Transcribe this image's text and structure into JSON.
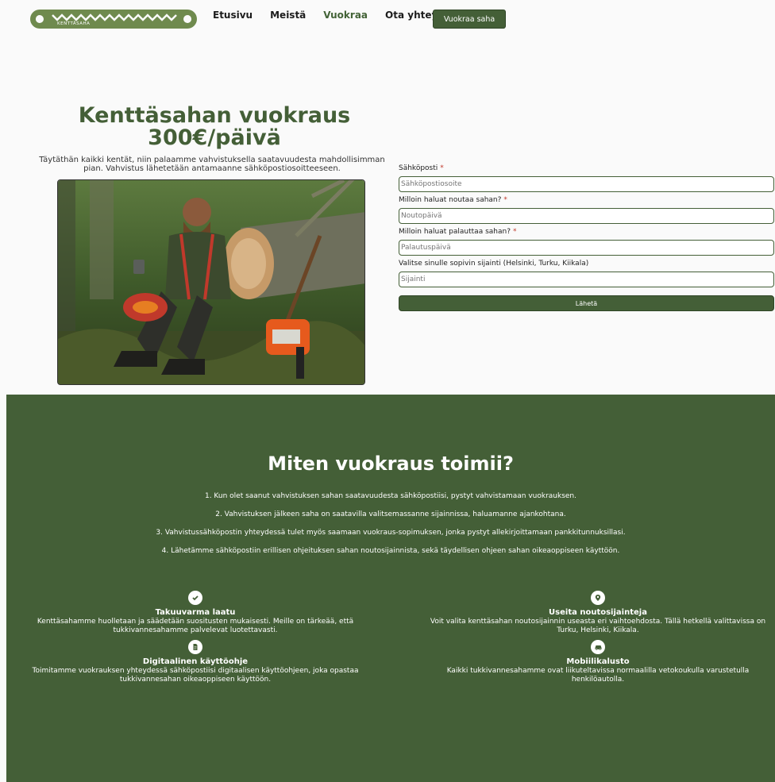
{
  "nav": {
    "logo_text": "KENTTÄSAHA",
    "links": [
      "Etusivu",
      "Meistä",
      "Vuokraa",
      "Ota yhteyttä"
    ],
    "cta": "Vuokraa saha"
  },
  "hero": {
    "title": "Kenttäsahan vuokraus 300€/päivä",
    "description": "Täytäthän kaikki kentät, niin palaamme vahvistuksella saatavuudesta mahdollisimman pian. Vahvistus lähetetään antamaanne sähköpostiosoitteeseen."
  },
  "form": {
    "email_label": "Sähköposti",
    "email_placeholder": "Sähköpostiosoite",
    "pickup_label": "Milloin haluat noutaa sahan?",
    "pickup_placeholder": "Noutopäivä",
    "return_label": "Milloin haluat palauttaa sahan?",
    "return_placeholder": "Palautuspäivä",
    "location_label": "Valitse sinulle sopivin sijainti (Helsinki, Turku, Kiikala)",
    "location_placeholder": "Sijainti",
    "submit": "Lähetä",
    "required_mark": "*"
  },
  "how": {
    "title": "Miten vuokraus toimii?",
    "steps": [
      "1. Kun olet saanut vahvistuksen sahan saatavuudesta sähköpostiisi, pystyt vahvistamaan vuokrauksen.",
      "2. Vahvistuksen jälkeen saha on saatavilla valitsemassanne sijainnissa, haluamanne ajankohtana.",
      "3. Vahvistussähköpostin yhteydessä tulet myös saamaan vuokraus-sopimuksen, jonka pystyt allekirjoittamaan pankkitunnuksillasi.",
      "4. Lähetämme sähköpostiin erillisen ohjeituksen sahan noutosijainnista, sekä täydellisen ohjeen sahan oikeaoppiseen käyttöön."
    ]
  },
  "features": [
    {
      "icon": "check-circle-icon",
      "title": "Takuuvarma laatu",
      "text": "Kenttäsahamme huolletaan ja säädetään suositusten mukaisesti. Meille on tärkeää, että tukkivannesahamme palvelevat luotettavasti."
    },
    {
      "icon": "map-pin-icon",
      "title": "Useita noutosijainteja",
      "text": "Voit valita kenttäsahan noutosijainnin useasta eri vaihtoehdosta. Tällä hetkellä valittavissa on Turku, Helsinki, Kiikala."
    },
    {
      "icon": "document-icon",
      "title": "Digitaalinen käyttöohje",
      "text": "Toimitamme vuokrauksen yhteydessä sähköpostiisi digitaalisen käyttöohjeen, joka opastaa tukkivannesahan oikeaoppiseen käyttöön."
    },
    {
      "icon": "car-icon",
      "title": "Mobiilikalusto",
      "text": "Kaikki tukkivannesahamme ovat liikuteltavissa normaalilla vetokoukulla varustetulla henkilöautolla."
    }
  ],
  "colors": {
    "accent": "#445f37",
    "required": "#c0392b"
  }
}
